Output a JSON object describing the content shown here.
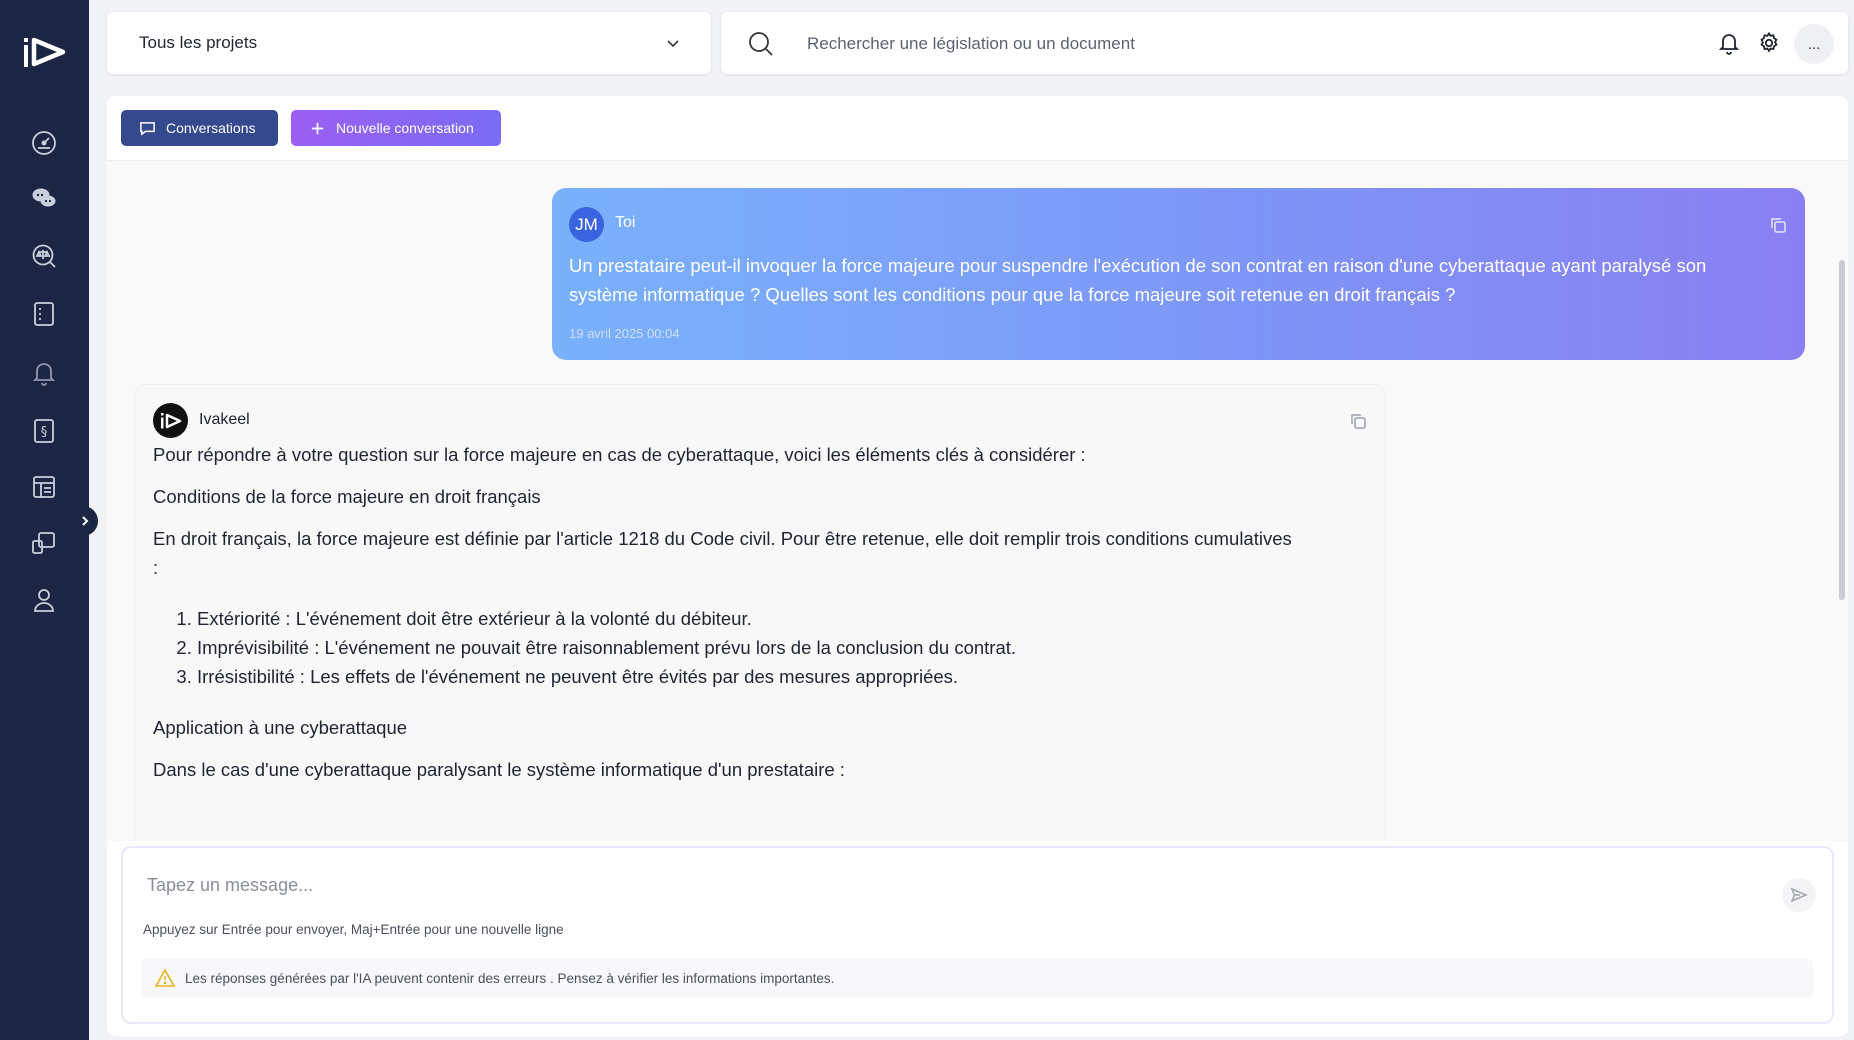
{
  "sidebar": {
    "logo": "ivakeel-logo",
    "items": [
      {
        "name": "dashboard",
        "icon": "gauge-icon"
      },
      {
        "name": "chat",
        "icon": "chat-bubbles-icon"
      },
      {
        "name": "legal-search",
        "icon": "scales-search-icon"
      },
      {
        "name": "documents",
        "icon": "document-icon"
      },
      {
        "name": "alerts",
        "icon": "bell-icon"
      },
      {
        "name": "legislation",
        "icon": "section-book-icon"
      },
      {
        "name": "templates",
        "icon": "layout-icon"
      },
      {
        "name": "devices",
        "icon": "devices-icon"
      },
      {
        "name": "profile",
        "icon": "user-icon"
      }
    ]
  },
  "header": {
    "project_select": "Tous les projets",
    "search_placeholder": "Rechercher une législation ou un document",
    "more_label": "..."
  },
  "toolbar": {
    "conversations_label": "Conversations",
    "new_conversation_label": "Nouvelle conversation"
  },
  "messages": {
    "user": {
      "initials": "JM",
      "name": "Toi",
      "text": "Un prestataire peut-il invoquer la force majeure pour suspendre l'exécution de son contrat en raison d'une cyberattaque ayant paralysé son système informatique ? Quelles sont les conditions pour que la force majeure soit retenue en droit français ?",
      "time": "19 avril 2025 00:04"
    },
    "assistant": {
      "name": "Ivakeel",
      "intro": "Pour répondre à votre question sur la force majeure en cas de cyberattaque, voici les éléments clés à considérer :",
      "heading1": "Conditions de la force majeure en droit français",
      "para1": "En droit français, la force majeure est définie par l'article 1218 du Code civil. Pour être retenue, elle doit remplir trois conditions cumulatives :",
      "conditions": [
        "Extériorité : L'événement doit être extérieur à la volonté du débiteur.",
        "Imprévisibilité : L'événement ne pouvait être raisonnablement prévu lors de la conclusion du contrat.",
        "Irrésistibilité : Les effets de l'événement ne peuvent être évités par des mesures appropriées."
      ],
      "heading2": "Application à une cyberattaque",
      "para2": "Dans le cas d'une cyberattaque paralysant le système informatique d'un prestataire :"
    }
  },
  "composer": {
    "placeholder": "Tapez un message...",
    "hint": "Appuyez sur Entrée pour envoyer, Maj+Entrée pour une nouvelle ligne",
    "warning": "Les réponses générées par l'IA peuvent contenir des erreurs . Pensez à vérifier les informations importantes."
  },
  "colors": {
    "sidebar_bg": "#1c2644",
    "conversations_btn": "#34498e",
    "new_conv_gradient": [
      "#9c5ff2",
      "#7a6cf4"
    ],
    "user_bubble_gradient": [
      "#79b1fb",
      "#8a7ff1"
    ],
    "avatar_jm": "#3a63df",
    "warning_icon": "#e6b422"
  }
}
